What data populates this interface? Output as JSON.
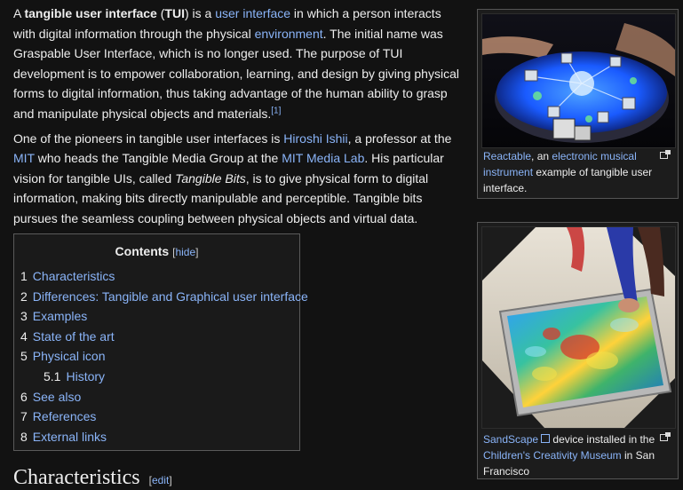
{
  "intro": {
    "p1_a": "A ",
    "p1_bold1": "tangible user interface",
    "p1_b": " (",
    "p1_bold2": "TUI",
    "p1_c": ") is a ",
    "p1_link1": "user interface",
    "p1_d": " in which a person interacts with digital information through the physical ",
    "p1_link2": "environment",
    "p1_e": ". The initial name was Graspable User Interface, which is no longer used. The purpose of TUI development is to empower collaboration, learning, and design by giving physical forms to digital information, thus taking advantage of the human ability to grasp and manipulate physical objects and materials.",
    "p1_ref": "[1]",
    "p2_a": "One of the pioneers in tangible user interfaces is ",
    "p2_link1": "Hiroshi Ishii",
    "p2_b": ", a professor at the ",
    "p2_link2": "MIT",
    "p2_c": " who heads the Tangible Media Group at the ",
    "p2_link3": "MIT Media Lab",
    "p2_d": ". His particular vision for tangible UIs, called ",
    "p2_italic": "Tangible Bits",
    "p2_e": ", is to give physical form to digital information, making bits directly manipulable and perceptible. Tangible bits pursues the seamless coupling between physical objects and virtual data."
  },
  "toc": {
    "title": "Contents",
    "hide_open": "[",
    "hide_label": "hide",
    "hide_close": "]",
    "items": [
      {
        "num": "1",
        "label": "Characteristics"
      },
      {
        "num": "2",
        "label": "Differences: Tangible and Graphical user interface"
      },
      {
        "num": "3",
        "label": "Examples"
      },
      {
        "num": "4",
        "label": "State of the art"
      },
      {
        "num": "5",
        "label": "Physical icon"
      },
      {
        "num": "5.1",
        "label": "History"
      },
      {
        "num": "6",
        "label": "See also"
      },
      {
        "num": "7",
        "label": "References"
      },
      {
        "num": "8",
        "label": "External links"
      }
    ]
  },
  "heading": {
    "title": "Characteristics",
    "edit_open": "[",
    "edit_label": "edit",
    "edit_close": "]"
  },
  "figure1": {
    "link1": "Reactable",
    "text1": ", an ",
    "link2": "electronic musical instrument",
    "text2": " example of tangible user interface."
  },
  "figure2": {
    "link1": "SandScape",
    "text1": " device installed in the ",
    "link2": "Children's Creativity Museum",
    "text2": " in San Francisco"
  },
  "colors": {
    "background": "#121212",
    "link": "#8ab4f8",
    "text": "#ededed"
  }
}
